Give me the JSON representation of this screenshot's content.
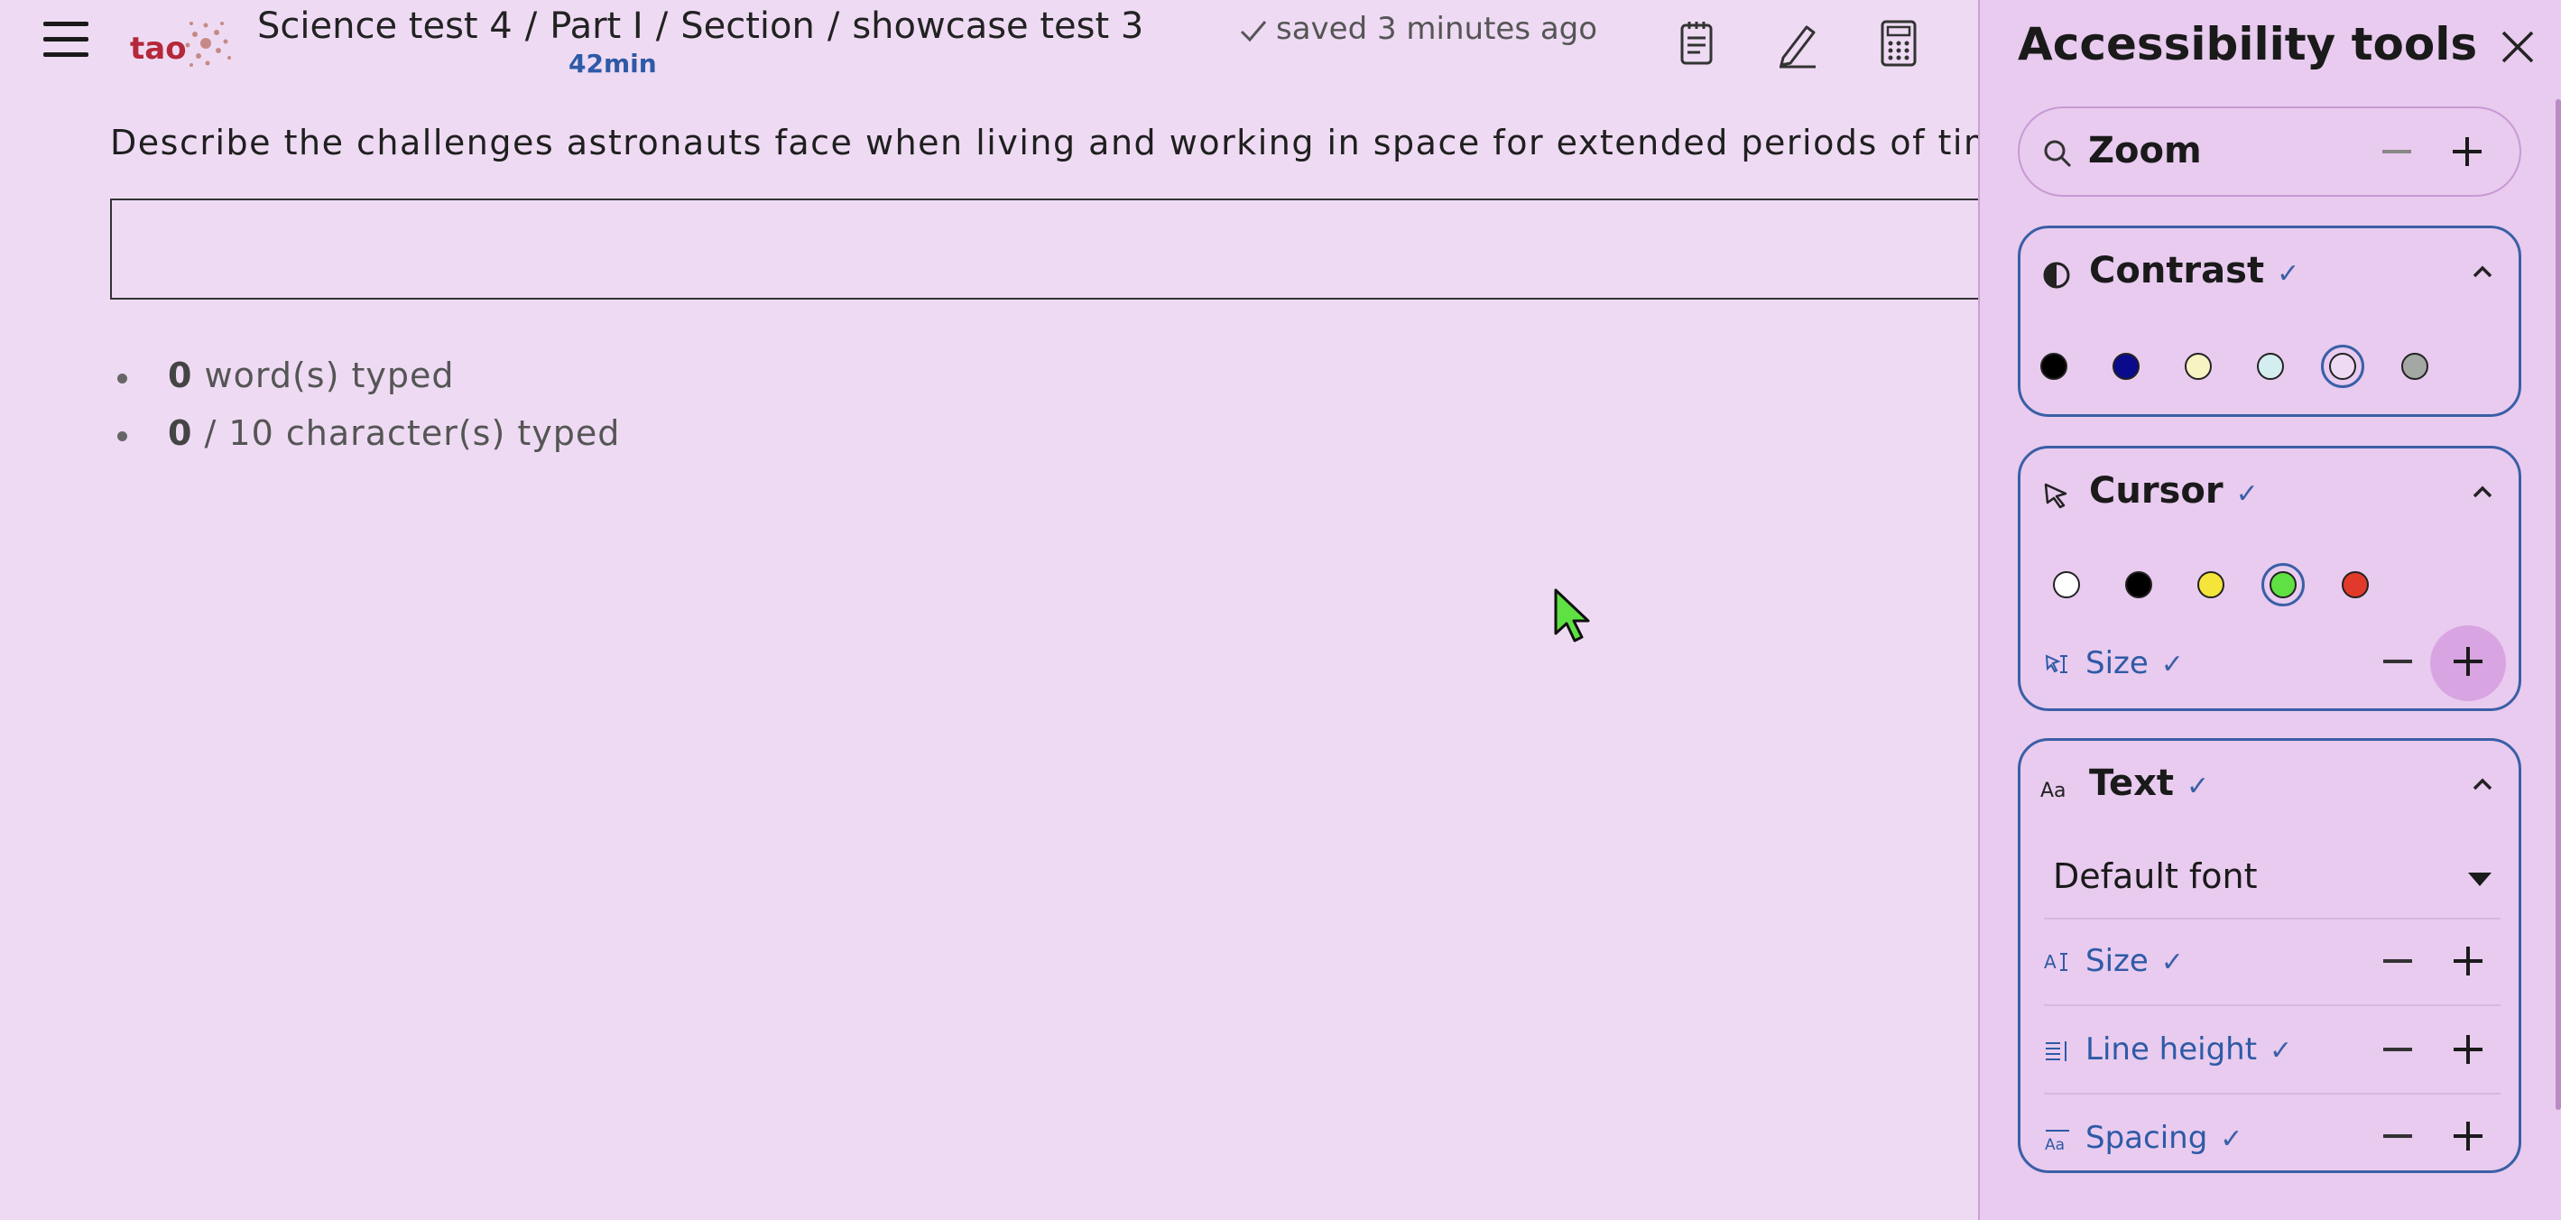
{
  "header": {
    "logo_text": "tao",
    "breadcrumb": [
      "Science test 4",
      "Part I",
      "Section",
      "showcase test 3"
    ],
    "separator": "/",
    "timer": "42min",
    "saved_status": "saved 3 minutes ago"
  },
  "main": {
    "prompt": "Describe the challenges astronauts face when living and working in space for extended periods of time.",
    "answer_value": "",
    "word_count": "0",
    "word_label": "word(s) typed",
    "char_count": "0",
    "char_label": "/ 10 character(s) typed"
  },
  "panel": {
    "title": "Accessibility tools",
    "zoom": {
      "label": "Zoom"
    },
    "contrast": {
      "label": "Contrast",
      "swatches": [
        "#000000",
        "#0a0a8c",
        "#f8f3c2",
        "#d4eef0",
        "#eedbf3",
        "#a4a8a4"
      ],
      "selected_index": 4
    },
    "cursor": {
      "label": "Cursor",
      "swatches": [
        "#ffffff",
        "#000000",
        "#f5e53a",
        "#5fe043",
        "#e23a2a"
      ],
      "selected_index": 3,
      "size_label": "Size"
    },
    "text": {
      "label": "Text",
      "font_value": "Default font",
      "size_label": "Size",
      "line_height_label": "Line height",
      "spacing_label": "Spacing"
    },
    "check_mark": "✓"
  }
}
